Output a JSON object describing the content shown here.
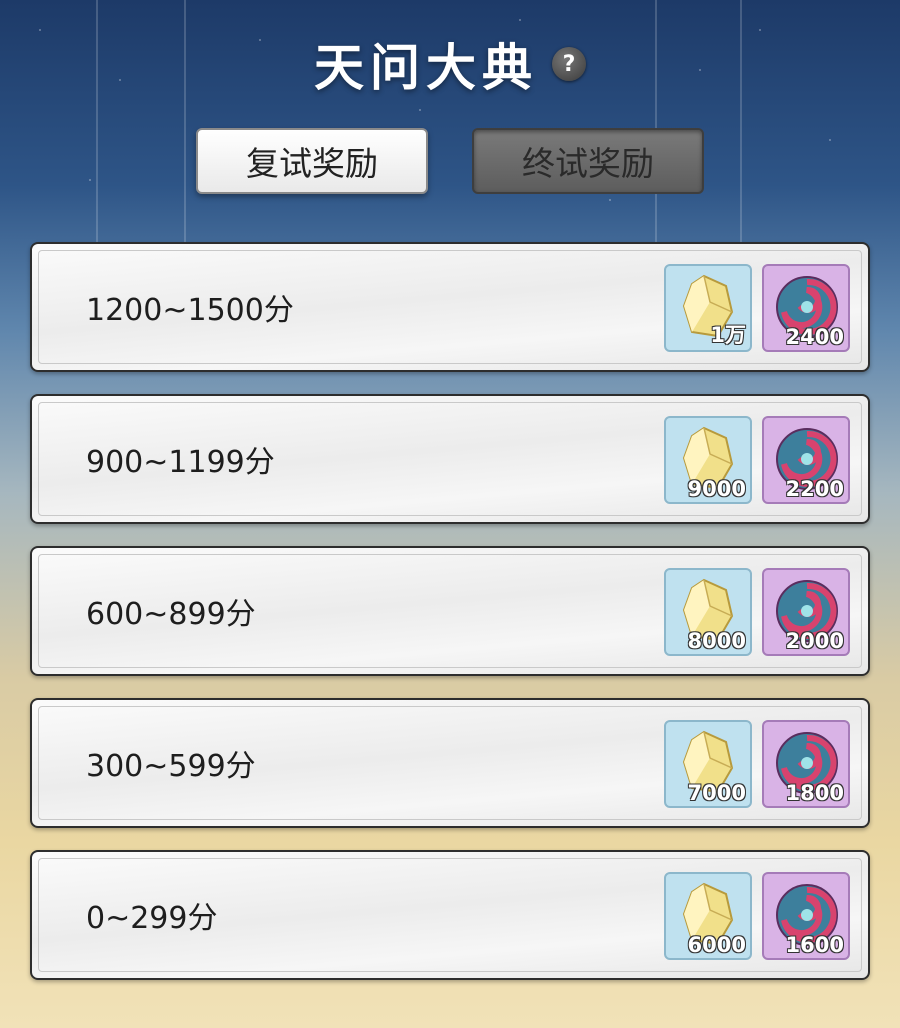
{
  "title": "天问大典",
  "tabs": [
    {
      "label": "复试奖励",
      "active": true
    },
    {
      "label": "终试奖励",
      "active": false
    }
  ],
  "rows": [
    {
      "range": "1200~1500分",
      "rewards": [
        {
          "icon": "crystal-icon",
          "qty": "1万"
        },
        {
          "icon": "swirl-orb-icon",
          "qty": "2400"
        }
      ]
    },
    {
      "range": "900~1199分",
      "rewards": [
        {
          "icon": "crystal-icon",
          "qty": "9000"
        },
        {
          "icon": "swirl-orb-icon",
          "qty": "2200"
        }
      ]
    },
    {
      "range": "600~899分",
      "rewards": [
        {
          "icon": "crystal-icon",
          "qty": "8000"
        },
        {
          "icon": "swirl-orb-icon",
          "qty": "2000"
        }
      ]
    },
    {
      "range": "300~599分",
      "rewards": [
        {
          "icon": "crystal-icon",
          "qty": "7000"
        },
        {
          "icon": "swirl-orb-icon",
          "qty": "1800"
        }
      ]
    },
    {
      "range": "0~299分",
      "rewards": [
        {
          "icon": "crystal-icon",
          "qty": "6000"
        },
        {
          "icon": "swirl-orb-icon",
          "qty": "1600"
        }
      ]
    }
  ]
}
